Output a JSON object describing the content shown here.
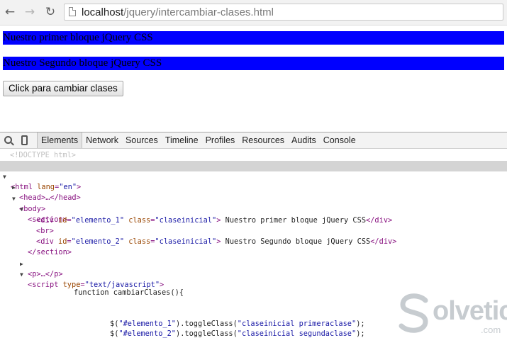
{
  "browser": {
    "nav": {
      "back": "←",
      "forward": "→",
      "reload": "↻"
    },
    "url_host": "localhost",
    "url_path": "/jquery/intercambiar-clases.html"
  },
  "page": {
    "bloque1": "Nuestro primer bloque jQuery CSS",
    "bloque2": "Nuestro Segundo bloque jQuery CSS",
    "button": "Click para cambiar clases",
    "block_color": "#0000ff"
  },
  "devtools": {
    "tabs": [
      "Elements",
      "Network",
      "Sources",
      "Timeline",
      "Profiles",
      "Resources",
      "Audits",
      "Console"
    ],
    "active_tab": "Elements",
    "code": {
      "doctype": "<!DOCTYPE html>",
      "html_open": "<html",
      "html_attr": "lang",
      "html_val": "\"en\"",
      "head": "<head>…</head>",
      "body": "<body>",
      "section_open": "<section>",
      "div1": {
        "open": "<div",
        "id_attr": "id",
        "id_val": "\"elemento_1\"",
        "class_attr": "class",
        "class_val": "\"claseinicial\"",
        "text": "Nuestro primer bloque jQuery CSS",
        "close": "</div>"
      },
      "br": "<br>",
      "div2": {
        "open": "<div",
        "id_attr": "id",
        "id_val": "\"elemento_2\"",
        "class_attr": "class",
        "class_val": "\"claseinicial\"",
        "text": "Nuestro Segundo bloque jQuery CSS",
        "close": "</div>"
      },
      "section_close": "</section>",
      "p": "<p>…</p>",
      "script_open": "<script",
      "script_attr": "type",
      "script_val": "\"text/javascript\"",
      "fn": "function cambiarClases(){",
      "call1_pre": "$(",
      "call1_sel": "\"#elemento_1\"",
      "call1_mid": ").toggleClass(",
      "call1_arg": "\"claseinicial primeraclase\"",
      "call1_end": ");",
      "call2_pre": "$(",
      "call2_sel": "\"#elemento_2\"",
      "call2_mid": ").toggleClass(",
      "call2_arg": "\"claseinicial segundaclase\"",
      "call2_end": ");"
    }
  },
  "watermark": {
    "name": "olvetic",
    "suffix": ".com"
  }
}
